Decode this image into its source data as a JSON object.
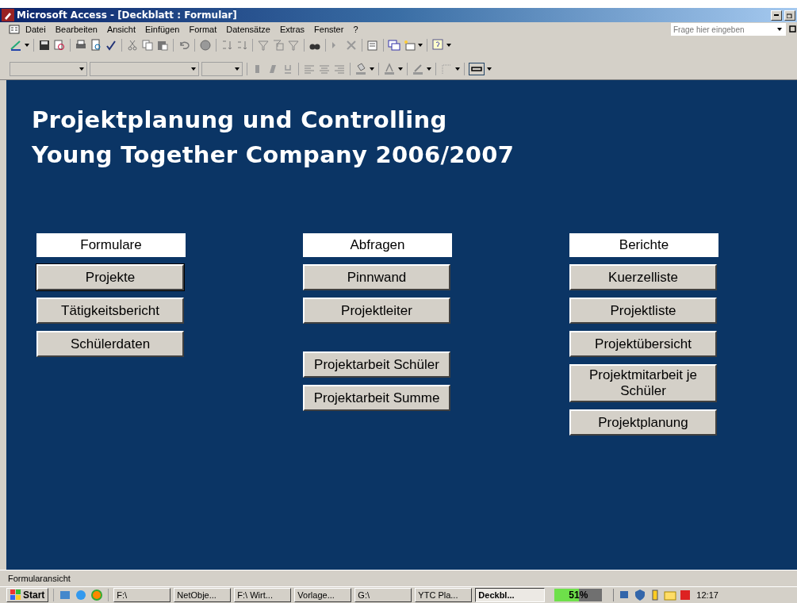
{
  "window": {
    "title": "Microsoft Access - [Deckblatt : Formular]"
  },
  "menu": [
    "Datei",
    "Bearbeiten",
    "Ansicht",
    "Einfügen",
    "Format",
    "Datensätze",
    "Extras",
    "Fenster",
    "?"
  ],
  "help_field": {
    "placeholder": "Frage hier eingeben"
  },
  "form": {
    "title_lines": [
      "Projektplanung und Controlling",
      "Young Together Company 2006/2007"
    ],
    "columns": [
      {
        "header": "Formulare",
        "groups": [
          {
            "buttons": [
              {
                "label": "Projekte",
                "focused": true
              },
              {
                "label": "Tätigkeitsbericht",
                "focused": false
              },
              {
                "label": "Schülerdaten",
                "focused": false
              }
            ]
          }
        ]
      },
      {
        "header": "Abfragen",
        "groups": [
          {
            "buttons": [
              {
                "label": "Pinnwand",
                "focused": false
              },
              {
                "label": "Projektleiter",
                "focused": false
              }
            ]
          },
          {
            "buttons": [
              {
                "label": "Projektarbeit Schüler",
                "focused": false
              },
              {
                "label": "Projektarbeit Summe",
                "focused": false
              }
            ]
          }
        ]
      },
      {
        "header": "Berichte",
        "groups": [
          {
            "buttons": [
              {
                "label": "Kuerzelliste",
                "focused": false
              },
              {
                "label": "Projektliste",
                "focused": false
              },
              {
                "label": "Projektübersicht",
                "focused": false
              },
              {
                "label": "Projektmitarbeit je Schüler",
                "focused": false
              },
              {
                "label": "Projektplanung",
                "focused": false
              }
            ]
          }
        ]
      }
    ]
  },
  "status_bar": {
    "text": "Formularansicht"
  },
  "taskbar": {
    "start": "Start",
    "tasks": [
      {
        "label": "F:\\",
        "selected": false
      },
      {
        "label": "NetObje...",
        "selected": false
      },
      {
        "label": "F:\\  Wirt...",
        "selected": false
      },
      {
        "label": "Vorlage...",
        "selected": false
      },
      {
        "label": "G:\\",
        "selected": false
      },
      {
        "label": "YTC  Pla...",
        "selected": false
      },
      {
        "label": "Deckbl...",
        "selected": true
      }
    ],
    "battery": {
      "reading": "51%",
      "level": 0.51
    },
    "clock": "12:17"
  }
}
